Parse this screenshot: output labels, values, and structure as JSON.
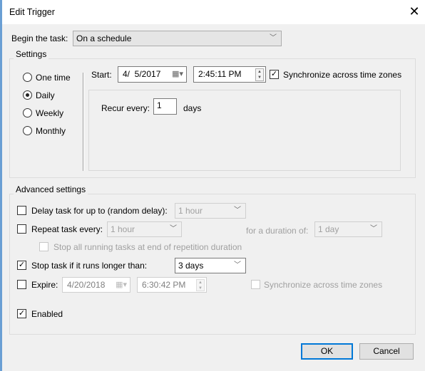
{
  "window": {
    "title": "Edit Trigger",
    "close_icon": "close-icon"
  },
  "begin": {
    "label": "Begin the task:",
    "value": "On a schedule"
  },
  "settings": {
    "label": "Settings",
    "options": [
      {
        "label": "One time",
        "selected": false
      },
      {
        "label": "Daily",
        "selected": true
      },
      {
        "label": "Weekly",
        "selected": false
      },
      {
        "label": "Monthly",
        "selected": false
      }
    ],
    "start_label": "Start:",
    "start_date": "4/  5/2017",
    "start_time": "2:45:11 PM",
    "sync_label": "Synchronize across time zones",
    "sync_checked": true,
    "recur_label": "Recur every:",
    "recur_value": "1",
    "recur_unit": "days"
  },
  "advanced": {
    "label": "Advanced settings",
    "delay": {
      "label": "Delay task for up to (random delay):",
      "checked": false,
      "value": "1 hour"
    },
    "repeat": {
      "label": "Repeat task every:",
      "checked": false,
      "value": "1 hour",
      "duration_label": "for a duration of:",
      "duration_value": "1 day"
    },
    "stop_all": {
      "label": "Stop all running tasks at end of repetition duration",
      "checked": false
    },
    "stop_task": {
      "label": "Stop task if it runs longer than:",
      "checked": true,
      "value": "3 days"
    },
    "expire": {
      "label": "Expire:",
      "checked": false,
      "date": "4/20/2018",
      "time": "6:30:42 PM",
      "sync_label": "Synchronize across time zones",
      "sync_checked": false
    },
    "enabled": {
      "label": "Enabled",
      "checked": true
    }
  },
  "buttons": {
    "ok": "OK",
    "cancel": "Cancel"
  },
  "colors": {
    "accent": "#0078d7",
    "background": "#f0f0f0"
  }
}
